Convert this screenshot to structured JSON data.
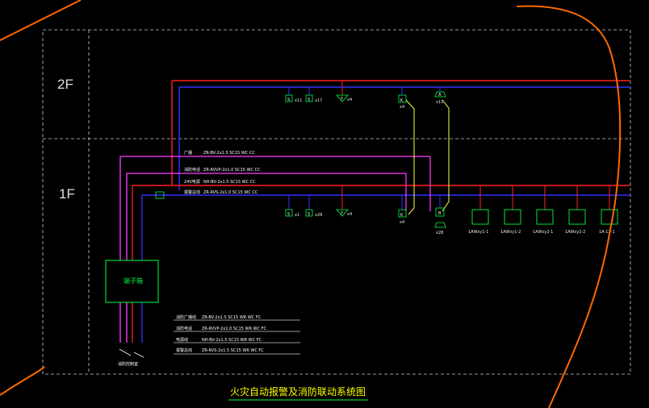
{
  "floors": {
    "upper": "2F",
    "lower": "1F"
  },
  "terminal_box": {
    "label": "端子箱"
  },
  "outgoing_label": "消防控制室",
  "main_lines": [
    {
      "name": "广播",
      "spec": "ZR-BV-2x1.5 SC15 WC CC"
    },
    {
      "name": "消防电话",
      "spec": "ZR-RVVP-2x1.0 SC15 WC CC"
    },
    {
      "name": "24V电源",
      "spec": "NH-BV-2x1.5 SC15 WC CC"
    },
    {
      "name": "报警总线",
      "spec": "ZR-RVS-2x1.0 SC15 WC CC"
    }
  ],
  "legend": [
    {
      "name": "消防广播线",
      "spec": "ZR-BV-2x1.5 SC15 WR WC FC"
    },
    {
      "name": "消防电话",
      "spec": "ZR-RVVP-2x1.0 SC15 WR WC FC"
    },
    {
      "name": "电源线",
      "spec": "NH-BV-2x1.5 SC15 WR WC FC"
    },
    {
      "name": "报警总线",
      "spec": "ZR-RVS-2x1.5 SC15 WR WC FC"
    }
  ],
  "upper_devices": [
    {
      "symbol": "S",
      "label": "x11"
    },
    {
      "symbol": "S",
      "label": "x17"
    },
    {
      "symbol": "Y",
      "label": "x4"
    },
    {
      "symbol": "K",
      "label": "x4"
    },
    {
      "symbol": "A",
      "label": "x11"
    }
  ],
  "lower_devices": [
    {
      "symbol": "S",
      "label": "x1"
    },
    {
      "symbol": "S",
      "label": "x28"
    },
    {
      "symbol": "Y",
      "label": "x4"
    },
    {
      "symbol": "K",
      "label": "x4"
    },
    {
      "symbol": "B",
      "label": "x28"
    }
  ],
  "fan_units": [
    {
      "label": "1AWxy1-1"
    },
    {
      "label": "1AWxy1-2"
    },
    {
      "label": "1AWxy2-1"
    },
    {
      "label": "1AWxy2-2"
    },
    {
      "label": "1A-12-1"
    }
  ],
  "title": "火灾自动报警及消防联动系统图",
  "colors": {
    "power": "#ff2020",
    "bus": "#3030ff",
    "broadcast": "#ff40ff",
    "phone": "#ffffff",
    "device": "#00ff40",
    "riser": "#ffff40",
    "markup": "#ff6a00",
    "title": "#ffff00"
  }
}
